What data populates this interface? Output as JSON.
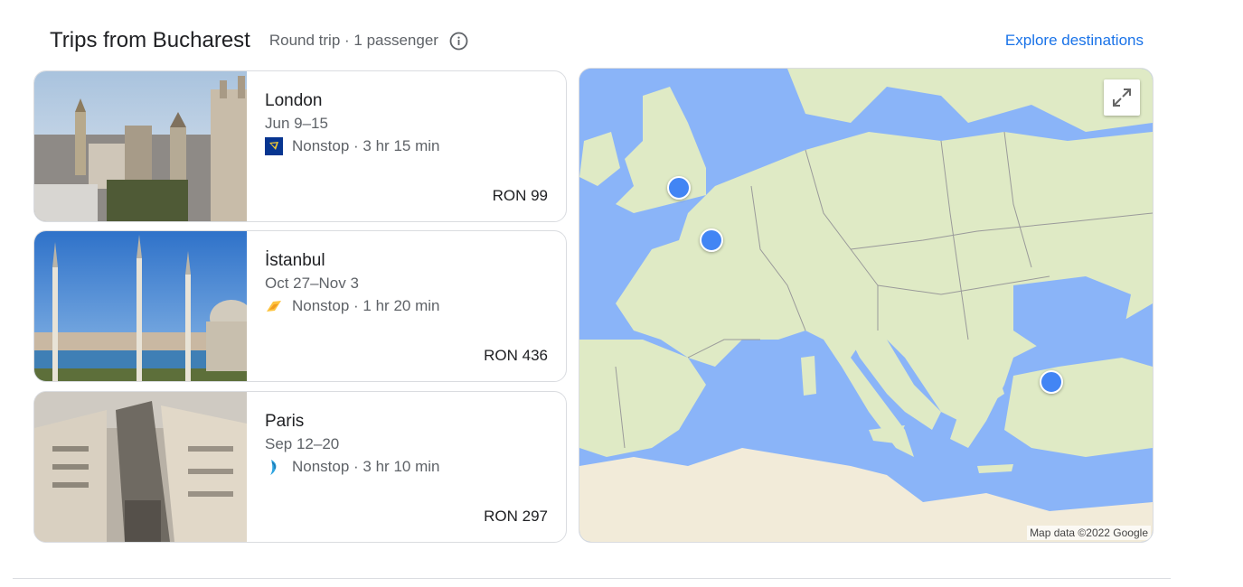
{
  "header": {
    "title": "Trips from Bucharest",
    "subtitle": "Round trip · 1 passenger",
    "explore_label": "Explore destinations"
  },
  "colors": {
    "accent": "#1a73e8",
    "marker": "#4285f4",
    "water": "#8ab4f8",
    "land": "#dfeac5"
  },
  "trips": [
    {
      "city": "London",
      "dates": "Jun 9–15",
      "flight": "Nonstop · 3 hr 15 min",
      "price": "RON 99",
      "airline_icon": "ryanair-harp-icon"
    },
    {
      "city": "İstanbul",
      "dates": "Oct 27–Nov 3",
      "flight": "Nonstop · 1 hr 20 min",
      "price": "RON 436",
      "airline_icon": "pegasus-icon"
    },
    {
      "city": "Paris",
      "dates": "Sep 12–20",
      "flight": "Nonstop · 3 hr 10 min",
      "price": "RON 297",
      "airline_icon": "wizz-icon"
    }
  ],
  "map": {
    "attribution": "Map data ©2022 Google"
  }
}
